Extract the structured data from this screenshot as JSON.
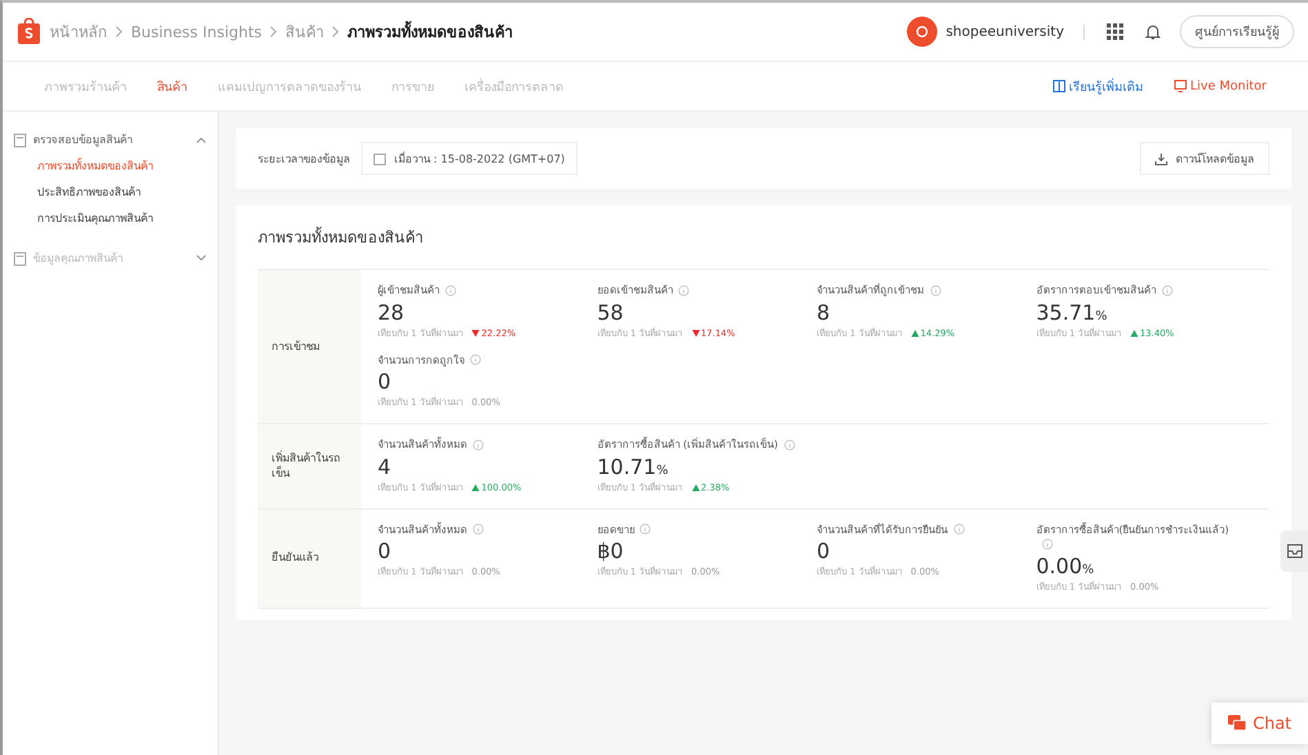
{
  "header": {
    "breadcrumbs": [
      "หน้าหลัก",
      "Business Insights",
      "สินค้า",
      "ภาพรวมทั้งหมดของสินค้า"
    ],
    "shop_name": "shopeeuniversity",
    "learning_center": "ศูนย์การเรียนรู้ผู้"
  },
  "tabs": [
    {
      "label": "ภาพรวมร้านค้า",
      "selected": false
    },
    {
      "label": "สินค้า",
      "selected": true
    },
    {
      "label": "แคมเปญการตลาดของร้าน",
      "selected": false
    },
    {
      "label": "การขาย",
      "selected": false
    },
    {
      "label": "เครื่องมือการตลาด",
      "selected": false
    }
  ],
  "tab_links": [
    {
      "label": "เรียนรู้เพิ่มเติม",
      "kind": "learn"
    },
    {
      "label": "Live Monitor",
      "kind": "live"
    }
  ],
  "sidebar": {
    "groups": [
      {
        "label": "ตรวจสอบข้อมูลสินค้า",
        "expanded": true,
        "children": [
          {
            "label": "ภาพรวมทั้งหมดของสินค้า",
            "selected": true
          },
          {
            "label": "ประสิทธิภาพของสินค้า",
            "selected": false
          },
          {
            "label": "การประเมินคุณภาพสินค้า",
            "selected": false
          }
        ]
      },
      {
        "label": "ข้อมูลคุณภาพสินค้า",
        "expanded": false
      }
    ]
  },
  "filter": {
    "label": "ระยะเวลาของข้อมูล",
    "date": "เมื่อวาน :  15-08-2022 (GMT+07)",
    "download": "ดาวน์โหลดข้อมูล"
  },
  "overview": {
    "title": "ภาพรวมทั้งหมดของสินค้า",
    "sections": [
      {
        "label": "การเข้าชม",
        "metrics": [
          {
            "name": "ผู้เข้าชมสินค้า",
            "value": "28",
            "compare": "เทียบกับ 1 วันที่ผ่านมา",
            "change": "22.22%",
            "kind": "down"
          },
          {
            "name": "ยอดเข้าชมสินค้า",
            "value": "58",
            "compare": "เทียบกับ 1 วันที่ผ่านมา",
            "change": "17.14%",
            "kind": "down"
          },
          {
            "name": "จำนวนสินค้าที่ถูกเข้าชม",
            "value": "8",
            "compare": "เทียบกับ 1 วันที่ผ่านมา",
            "change": "14.29%",
            "kind": "up"
          },
          {
            "name": "อัตราการตอบเข้าชมสินค้า",
            "value": "35.71",
            "unit": "%",
            "compare": "เทียบกับ 1 วันที่ผ่านมา",
            "change": "13.40%",
            "kind": "up"
          },
          {
            "name": "จำนวนการกดถูกใจ",
            "value": "0",
            "compare": "เทียบกับ 1 วันที่ผ่านมา",
            "change": "0.00%",
            "kind": "flat"
          }
        ]
      },
      {
        "label": "เพิ่มสินค้าในรถเข็น",
        "metrics": [
          {
            "name": "จำนวนสินค้าทั้งหมด",
            "value": "4",
            "compare": "เทียบกับ 1 วันที่ผ่านมา",
            "change": "100.00%",
            "kind": "up"
          },
          {
            "name": "อัตราการซื้อสินค้า (เพิ่มสินค้าในรถเข็น)",
            "value": "10.71",
            "unit": "%",
            "compare": "เทียบกับ 1 วันที่ผ่านมา",
            "change": "2.38%",
            "kind": "up"
          }
        ]
      },
      {
        "label": "ยืนยันแล้ว",
        "metrics": [
          {
            "name": "จำนวนสินค้าทั้งหมด",
            "value": "0",
            "compare": "เทียบกับ 1 วันที่ผ่านมา",
            "change": "0.00%",
            "kind": "flat"
          },
          {
            "name": "ยอดขาย",
            "value": "฿0",
            "compare": "เทียบกับ 1 วันที่ผ่านมา",
            "change": "0.00%",
            "kind": "flat"
          },
          {
            "name": "จำนวนสินค้าที่ได้รับการยืนยัน",
            "value": "0",
            "compare": "เทียบกับ 1 วันที่ผ่านมา",
            "change": "0.00%",
            "kind": "flat"
          },
          {
            "name": "อัตราการซื้อสินค้า(ยืนยันการชำระเงินแล้ว)",
            "value": "0.00",
            "unit": "%",
            "compare": "เทียบกับ 1 วันที่ผ่านมา",
            "change": "0.00%",
            "kind": "flat"
          }
        ]
      }
    ]
  },
  "chat": {
    "label": "Chat"
  }
}
